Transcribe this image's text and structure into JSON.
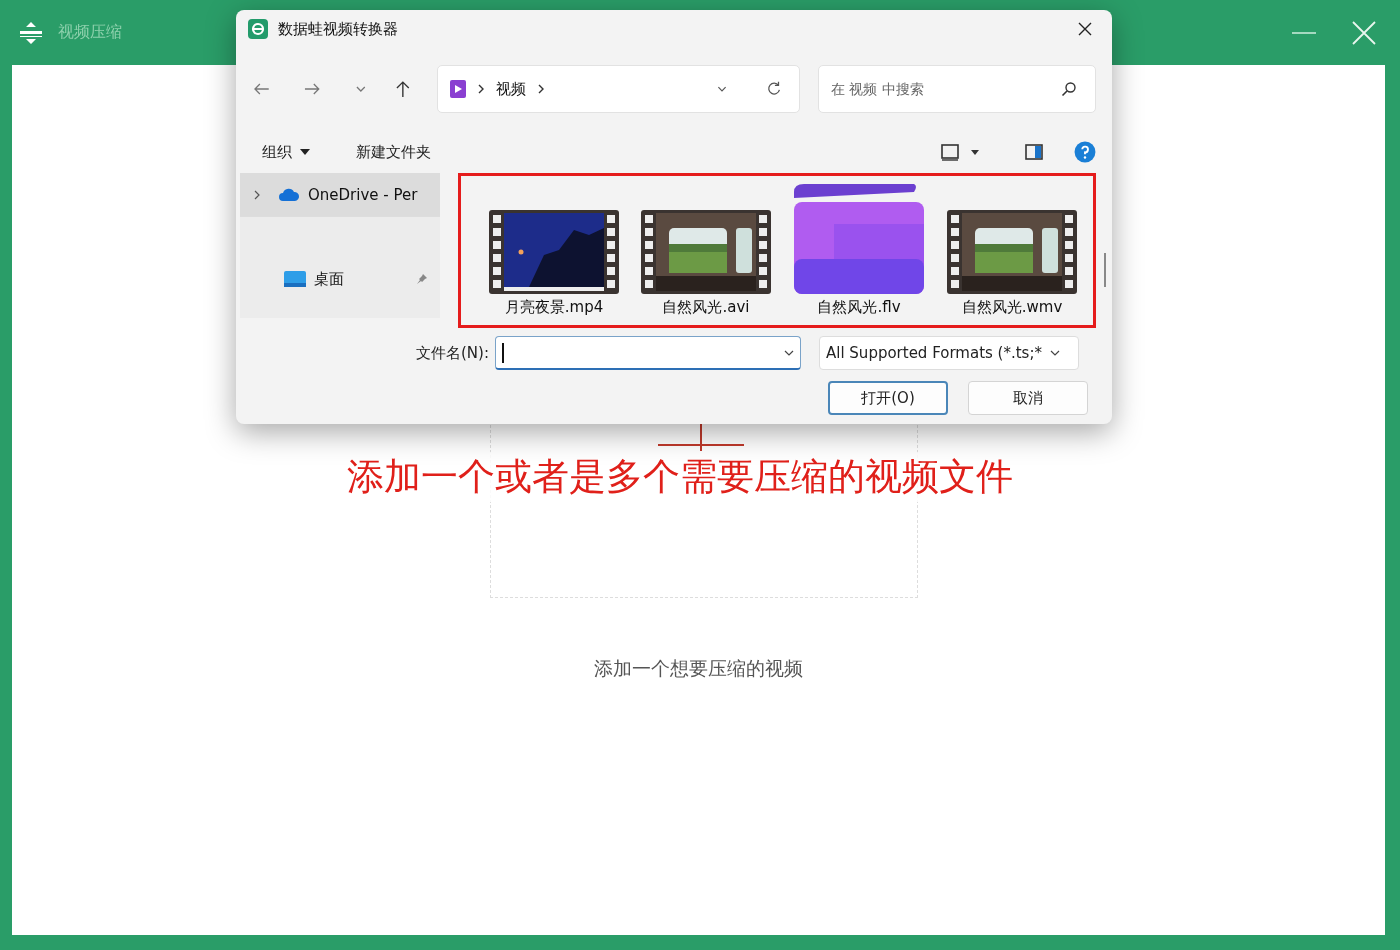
{
  "app": {
    "title": "视频压缩"
  },
  "dialog": {
    "title": "数据蛙视频转换器",
    "breadcrumb": [
      "视频"
    ],
    "search": {
      "placeholder": "在 视频 中搜索"
    },
    "toolbar": [
      "组织",
      "新建文件夹"
    ],
    "nav": [
      {
        "label": "OneDrive - Per",
        "kind": "cloud",
        "selected": true
      },
      {
        "label": "桌面",
        "kind": "desktop",
        "selected": false
      }
    ],
    "files": [
      {
        "name": "月亮夜景.mp4",
        "kind": "video"
      },
      {
        "name": "自然风光.avi",
        "kind": "video"
      },
      {
        "name": "自然风光.flv",
        "kind": "app"
      },
      {
        "name": "自然风光.wmv",
        "kind": "video"
      }
    ],
    "filename_label": "文件名(N):",
    "filter": "All Supported Formats (*.ts;*",
    "buttons": [
      {
        "label": "打开(O)",
        "default": true
      },
      {
        "label": "取消",
        "default": false
      }
    ]
  },
  "annotation": "添加一个或者是多个需要压缩的视频文件",
  "drop_hint": "添加一个想要压缩的视频"
}
